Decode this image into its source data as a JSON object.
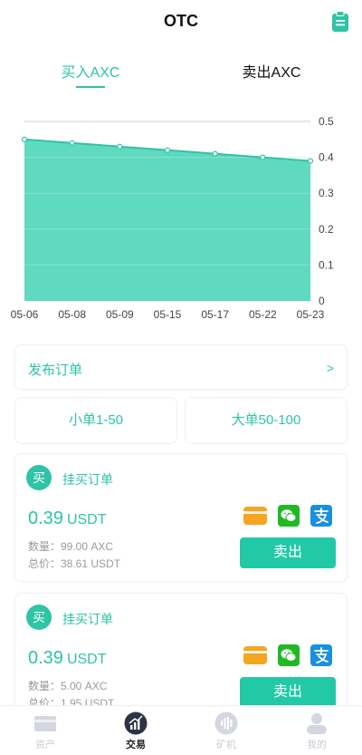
{
  "header": {
    "title": "OTC",
    "clipboard_icon": "clipboard-icon"
  },
  "tabs": [
    {
      "label": "买入AXC",
      "active": true
    },
    {
      "label": "卖出AXC",
      "active": false
    }
  ],
  "colors": {
    "accent": "#2ec4a5",
    "area_fill": "#5fd9bf",
    "area_line": "#2ec4a5"
  },
  "chart_data": {
    "type": "area",
    "categories": [
      "05-06",
      "05-08",
      "05-09",
      "05-15",
      "05-17",
      "05-22",
      "05-23"
    ],
    "values": [
      0.45,
      0.44,
      0.43,
      0.42,
      0.41,
      0.4,
      0.39
    ],
    "yticks": [
      "0.5",
      "0.4",
      "0.3",
      "0.2",
      "0.1",
      "0"
    ],
    "ylim": [
      0,
      0.5
    ],
    "y_axis_side": "right",
    "grid": true
  },
  "publish": {
    "label": "发布订单",
    "arrow": ">"
  },
  "size_filters": [
    {
      "label": "小单1-50"
    },
    {
      "label": "大单50-100"
    }
  ],
  "orders": [
    {
      "badge": "买",
      "title": "挂买订单",
      "price": "0.39",
      "unit": "USDT",
      "quantity": "数量：99.00 AXC",
      "total": "总价：38.61 USDT",
      "payments": [
        "bank-card-icon",
        "wechat-pay-icon",
        "alipay-icon"
      ],
      "action": "卖出"
    },
    {
      "badge": "买",
      "title": "挂买订单",
      "price": "0.39",
      "unit": "USDT",
      "quantity": "数量：5.00 AXC",
      "total": "总价：1.95 USDT",
      "payments": [
        "bank-card-icon",
        "wechat-pay-icon",
        "alipay-icon"
      ],
      "action": "卖出"
    }
  ],
  "tabbar": [
    {
      "label": "资产",
      "icon": "wallet-icon",
      "active": false
    },
    {
      "label": "交易",
      "icon": "trade-chart-icon",
      "active": true
    },
    {
      "label": "矿机",
      "icon": "miner-icon",
      "active": false
    },
    {
      "label": "我的",
      "icon": "user-icon",
      "active": false
    }
  ]
}
